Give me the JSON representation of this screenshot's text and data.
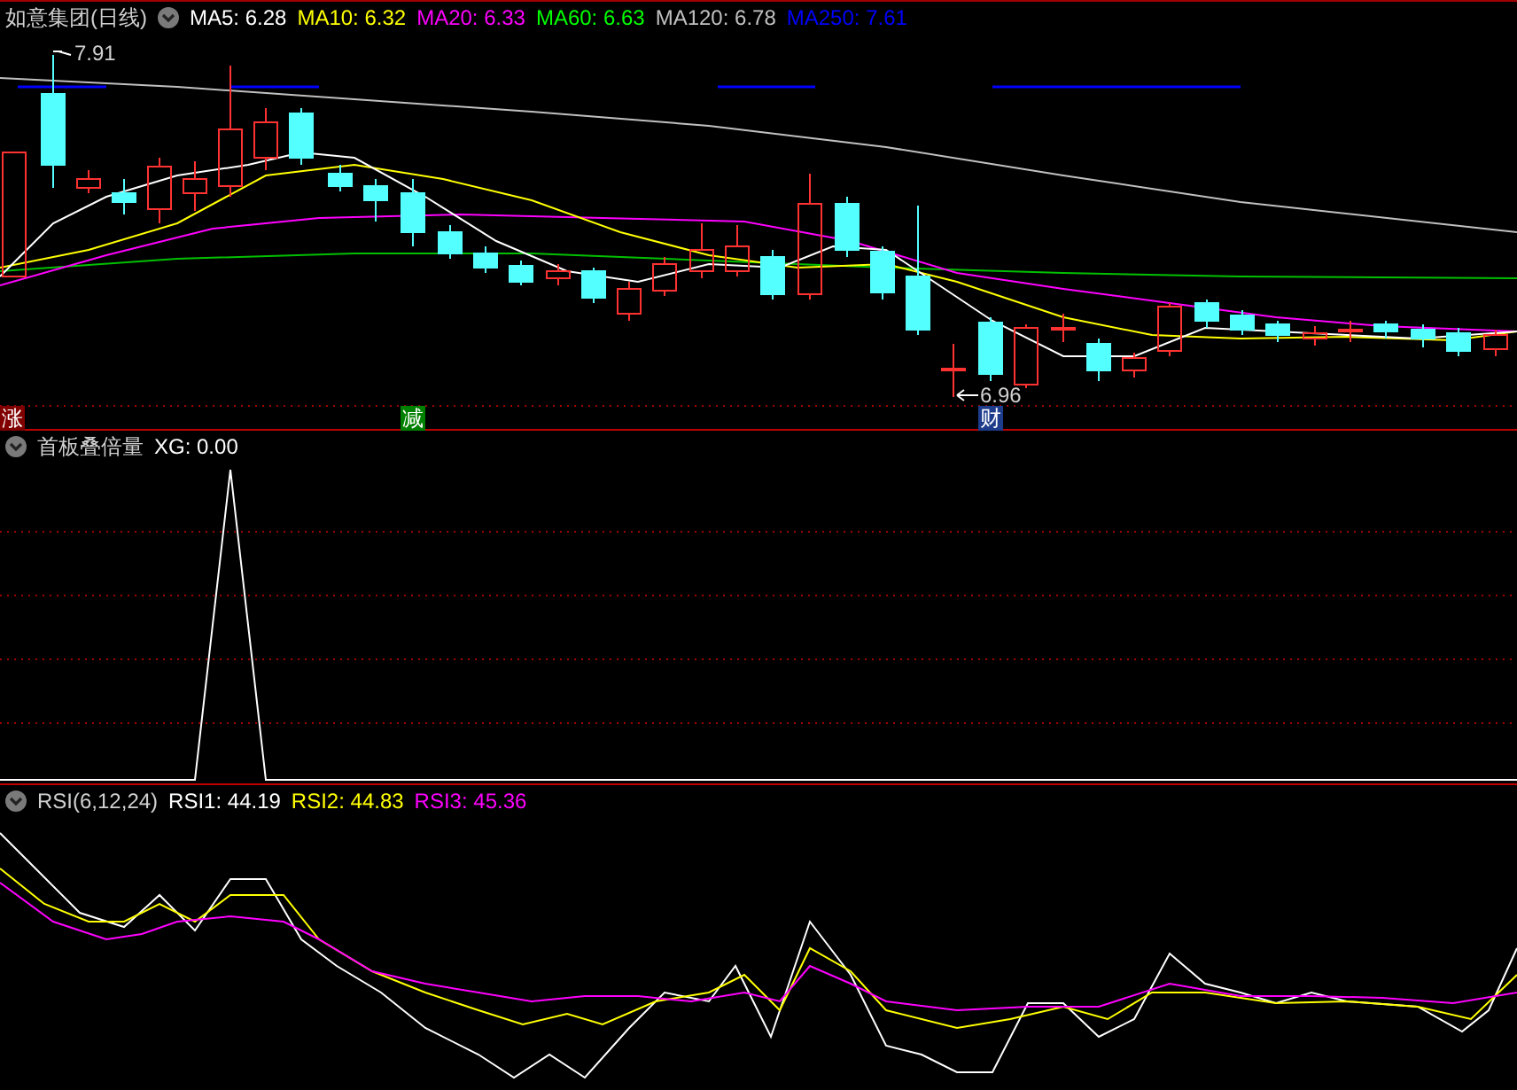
{
  "main_panel": {
    "title": "如意集团(日线)",
    "indicators": [
      {
        "label": "MA5: 6.28",
        "color": "#ffffff"
      },
      {
        "label": "MA10: 6.32",
        "color": "#ffff00"
      },
      {
        "label": "MA20: 6.33",
        "color": "#ff00ff"
      },
      {
        "label": "MA60: 6.63",
        "color": "#00ff00"
      },
      {
        "label": "MA120: 6.78",
        "color": "#c0c0c0"
      },
      {
        "label": "MA250: 7.61",
        "color": "#0000ff"
      }
    ],
    "high_label": "7.91",
    "low_label": "6.96",
    "markers": [
      {
        "text": "涨",
        "color": "#800000"
      },
      {
        "text": "减",
        "color": "#008000"
      },
      {
        "text": "财",
        "color": "#1e3c8c"
      }
    ]
  },
  "signal_panel": {
    "title": "首板叠倍量",
    "readings": [
      {
        "label": "XG: 0.00",
        "color": "#ffffff"
      }
    ]
  },
  "rsi_panel": {
    "title": "RSI(6,12,24)",
    "readings": [
      {
        "label": "RSI1: 44.19",
        "color": "#ffffff"
      },
      {
        "label": "RSI2: 44.83",
        "color": "#ffff00"
      },
      {
        "label": "RSI3: 45.36",
        "color": "#ff00ff"
      }
    ]
  }
}
